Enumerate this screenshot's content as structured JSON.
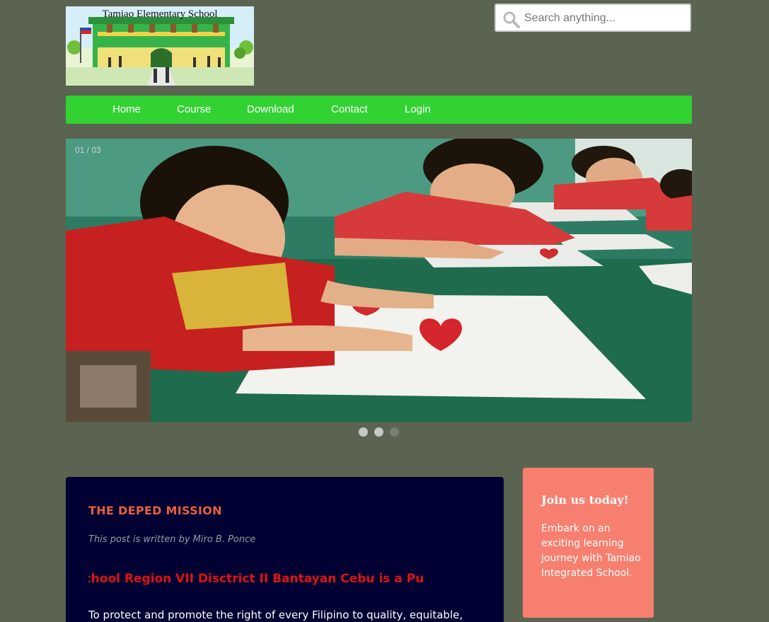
{
  "logo": {
    "text": "Tamiao Elementary School"
  },
  "search": {
    "placeholder": "Search anything..."
  },
  "nav": {
    "items": [
      {
        "label": "Home"
      },
      {
        "label": "Course"
      },
      {
        "label": "Download"
      },
      {
        "label": "Contact"
      },
      {
        "label": "Login"
      }
    ]
  },
  "slider": {
    "counter": "01 / 03",
    "image_alt": "children drawing red hearts at a classroom table",
    "slides_total": 3,
    "active_slide": 3
  },
  "post": {
    "title": "THE DEPED MISSION",
    "byline": "This post is written by Miro B. Ponce",
    "marquee": "Tamiao Integrated School Region VII Disctrict II Bantayan Cebu is a Pu",
    "body": "To protect and promote the right of every Filipino to quality, equitable,"
  },
  "join": {
    "title": "Join us today!",
    "text": "Embark on an exciting learning journey with Tamiao Integrated School."
  },
  "colors": {
    "page_bg": "#5b6351",
    "nav_bg": "#32d232",
    "post_bg": "#000033",
    "post_title": "#e8613d",
    "marquee": "#e01212",
    "join_bg": "#f77f70"
  }
}
